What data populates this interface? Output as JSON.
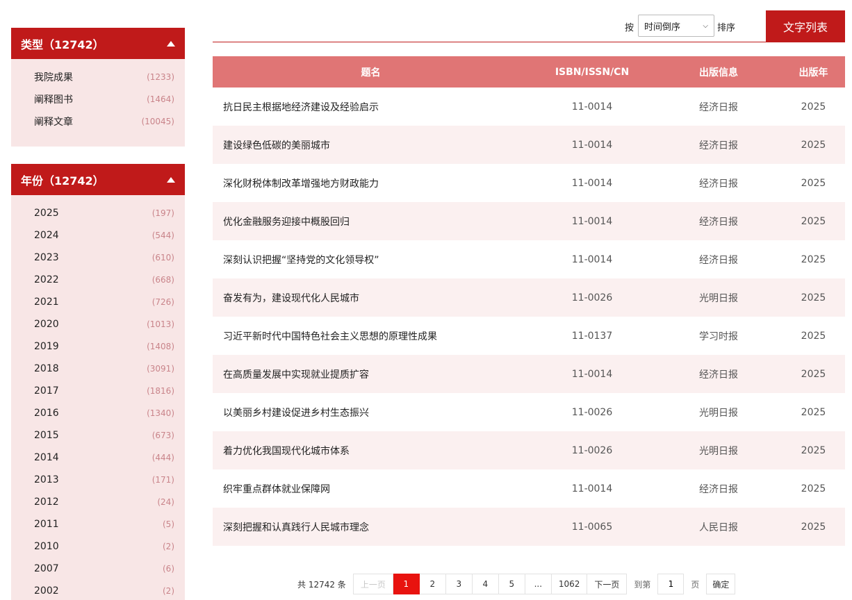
{
  "facets": {
    "type": {
      "title": "类型（12742）",
      "items": [
        {
          "label": "我院成果",
          "count": "(1233)"
        },
        {
          "label": "阐释图书",
          "count": "(1464)"
        },
        {
          "label": "阐释文章",
          "count": "(10045)"
        }
      ]
    },
    "year": {
      "title": "年份（12742）",
      "items": [
        {
          "label": "2025",
          "count": "(197)"
        },
        {
          "label": "2024",
          "count": "(544)"
        },
        {
          "label": "2023",
          "count": "(610)"
        },
        {
          "label": "2022",
          "count": "(668)"
        },
        {
          "label": "2021",
          "count": "(726)"
        },
        {
          "label": "2020",
          "count": "(1013)"
        },
        {
          "label": "2019",
          "count": "(1408)"
        },
        {
          "label": "2018",
          "count": "(3091)"
        },
        {
          "label": "2017",
          "count": "(1816)"
        },
        {
          "label": "2016",
          "count": "(1340)"
        },
        {
          "label": "2015",
          "count": "(673)"
        },
        {
          "label": "2014",
          "count": "(444)"
        },
        {
          "label": "2013",
          "count": "(171)"
        },
        {
          "label": "2012",
          "count": "(24)"
        },
        {
          "label": "2011",
          "count": "(5)"
        },
        {
          "label": "2010",
          "count": "(2)"
        },
        {
          "label": "2007",
          "count": "(6)"
        },
        {
          "label": "2002",
          "count": "(2)"
        }
      ]
    }
  },
  "toolbar": {
    "sort_prefix": "按",
    "sort_value": "时间倒序",
    "sort_suffix": "排序",
    "view_label": "文字列表"
  },
  "table": {
    "headers": [
      "题名",
      "ISBN/ISSN/CN",
      "出版信息",
      "出版年"
    ],
    "rows": [
      [
        "抗日民主根据地经济建设及经验启示",
        "11-0014",
        "经济日报",
        "2025"
      ],
      [
        "建设绿色低碳的美丽城市",
        "11-0014",
        "经济日报",
        "2025"
      ],
      [
        "深化财税体制改革增强地方财政能力",
        "11-0014",
        "经济日报",
        "2025"
      ],
      [
        "优化金融服务迎接中概股回归",
        "11-0014",
        "经济日报",
        "2025"
      ],
      [
        "深刻认识把握“坚持党的文化领导权”",
        "11-0014",
        "经济日报",
        "2025"
      ],
      [
        "奋发有为，建设现代化人民城市",
        "11-0026",
        "光明日报",
        "2025"
      ],
      [
        "习近平新时代中国特色社会主义思想的原理性成果",
        "11-0137",
        "学习时报",
        "2025"
      ],
      [
        "在高质量发展中实现就业提质扩容",
        "11-0014",
        "经济日报",
        "2025"
      ],
      [
        "以美丽乡村建设促进乡村生态振兴",
        "11-0026",
        "光明日报",
        "2025"
      ],
      [
        "着力优化我国现代化城市体系",
        "11-0026",
        "光明日报",
        "2025"
      ],
      [
        "织牢重点群体就业保障网",
        "11-0014",
        "经济日报",
        "2025"
      ],
      [
        "深刻把握和认真践行人民城市理念",
        "11-0065",
        "人民日报",
        "2025"
      ]
    ]
  },
  "pagination": {
    "total": "共 12742 条",
    "prev": "上一页",
    "pages": [
      "1",
      "2",
      "3",
      "4",
      "5",
      "...",
      "1062"
    ],
    "next": "下一页",
    "goto_label": "到第",
    "goto_value": "1",
    "goto_suffix": "页",
    "confirm": "确定"
  },
  "colors": {
    "brand_red": "#c01a1a",
    "header_pink": "#e07575",
    "active_page": "#e8130f"
  }
}
